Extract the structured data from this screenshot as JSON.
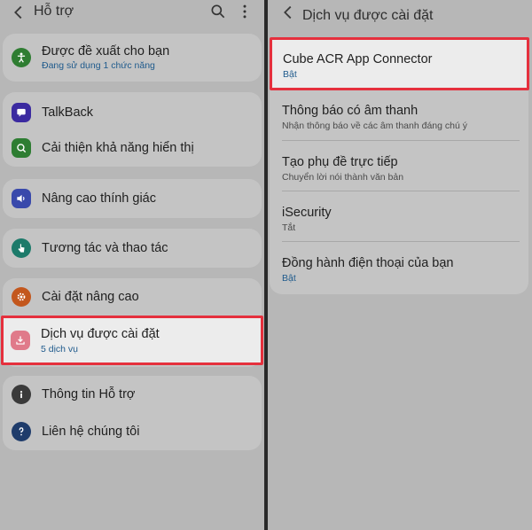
{
  "left": {
    "header": {
      "title": "Hỗ trợ"
    },
    "items": [
      {
        "title": "Được đề xuất cho bạn",
        "subtitle": "Đang sử dụng 1 chức năng",
        "icon": "accessibility-icon",
        "color": "#2f7d32"
      },
      {
        "title": "TalkBack",
        "icon": "talkback-icon",
        "color": "#3b2aa0"
      },
      {
        "title": "Cải thiện khả năng hiển thị",
        "icon": "visibility-icon",
        "color": "#2e7d32"
      },
      {
        "title": "Nâng cao thính giác",
        "icon": "hearing-icon",
        "color": "#3949ab"
      },
      {
        "title": "Tương tác và thao tác",
        "icon": "touch-icon",
        "color": "#1c7a6a"
      },
      {
        "title": "Cài đặt nâng cao",
        "icon": "gear-icon",
        "color": "#c3571d"
      },
      {
        "title": "Dịch vụ được cài đặt",
        "subtitle": "5 dịch vụ",
        "icon": "download-icon",
        "color": "#e07a8a"
      },
      {
        "title": "Thông tin Hỗ trợ",
        "icon": "info-icon",
        "color": "#3a3a3a"
      },
      {
        "title": "Liên hệ chúng tôi",
        "icon": "help-icon",
        "color": "#1f3c6b"
      }
    ]
  },
  "right": {
    "header": {
      "title": "Dịch vụ được cài đặt"
    },
    "items": [
      {
        "title": "Cube ACR App Connector",
        "subtitle": "Bật"
      },
      {
        "title": "Thông báo có âm thanh",
        "subtitle": "Nhận thông báo về các âm thanh đáng chú ý"
      },
      {
        "title": "Tạo phụ đề trực tiếp",
        "subtitle": "Chuyển lời nói thành văn bản"
      },
      {
        "title": "iSecurity",
        "subtitle": "Tắt"
      },
      {
        "title": "Đồng hành điện thoại của bạn",
        "subtitle": "Bật"
      }
    ]
  },
  "colors": {
    "highlight": "#e5303d",
    "accent": "#1e5a8c",
    "background": "#b7b7b7"
  }
}
